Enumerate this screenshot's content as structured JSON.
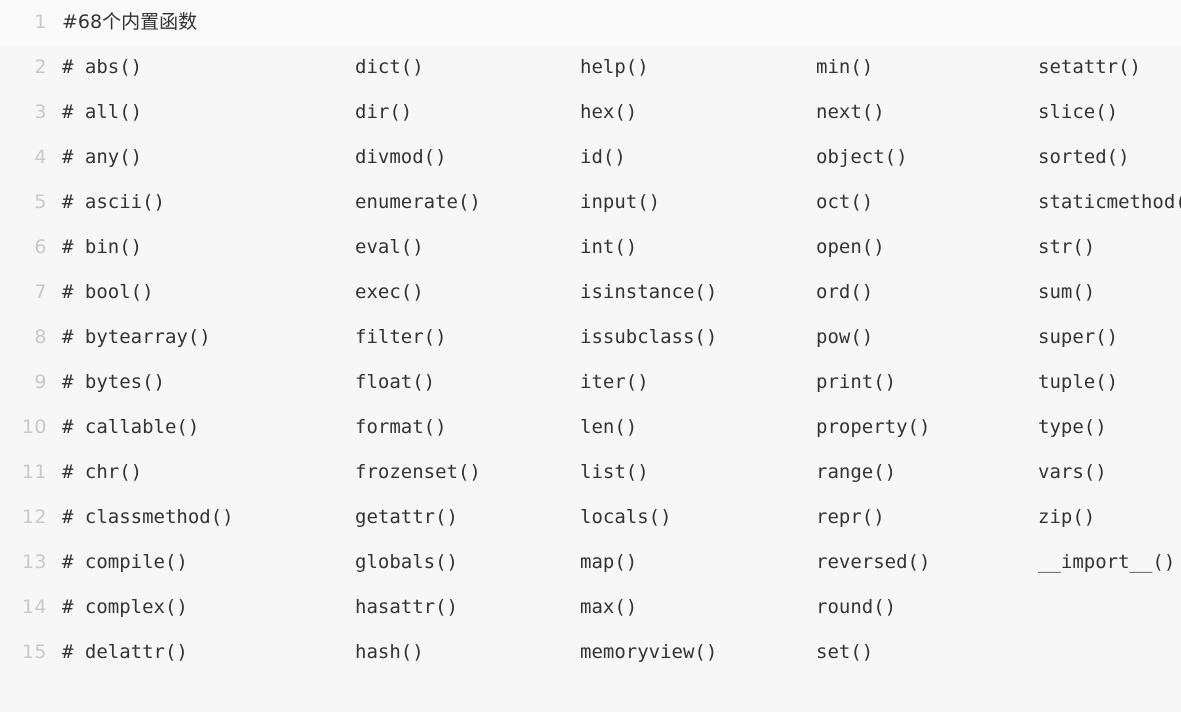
{
  "editor": {
    "background_color": "#f7f7f7",
    "active_line_color": "#fafafa",
    "text_color": "#333333",
    "line_number_color": "#c9c9c9",
    "font_size_px": 19,
    "line_height_px": 45,
    "language": "python",
    "total_lines": 15,
    "columns_x": [
      62,
      355,
      580,
      816,
      1038
    ],
    "right_edge_clipped": true
  },
  "heading": {
    "line_number": "1",
    "text": "#68个内置函数"
  },
  "line_numbers": [
    "1",
    "2",
    "3",
    "4",
    "5",
    "6",
    "7",
    "8",
    "9",
    "10",
    "11",
    "12",
    "13",
    "14",
    "15"
  ],
  "rows": [
    {
      "number": "2",
      "cells": [
        "# abs()",
        "dict()",
        "help()",
        "min()",
        "setattr()"
      ]
    },
    {
      "number": "3",
      "cells": [
        "# all()",
        "dir()",
        "hex()",
        "next()",
        "slice()"
      ]
    },
    {
      "number": "4",
      "cells": [
        "# any()",
        "divmod()",
        "id()",
        "object()",
        "sorted()"
      ]
    },
    {
      "number": "5",
      "cells": [
        "# ascii()",
        "enumerate()",
        "input()",
        "oct()",
        "staticmethod()"
      ]
    },
    {
      "number": "6",
      "cells": [
        "# bin()",
        "eval()",
        "int()",
        "open()",
        "str()"
      ]
    },
    {
      "number": "7",
      "cells": [
        "# bool()",
        "exec()",
        "isinstance()",
        "ord()",
        "sum()"
      ]
    },
    {
      "number": "8",
      "cells": [
        "# bytearray()",
        "filter()",
        "issubclass()",
        "pow()",
        "super()"
      ]
    },
    {
      "number": "9",
      "cells": [
        "# bytes()",
        "float()",
        "iter()",
        "print()",
        "tuple()"
      ]
    },
    {
      "number": "10",
      "cells": [
        "# callable()",
        "format()",
        "len()",
        "property()",
        "type()"
      ]
    },
    {
      "number": "11",
      "cells": [
        "# chr()",
        "frozenset()",
        "list()",
        "range()",
        "vars()"
      ]
    },
    {
      "number": "12",
      "cells": [
        "# classmethod()",
        "getattr()",
        "locals()",
        "repr()",
        "zip()"
      ]
    },
    {
      "number": "13",
      "cells": [
        "# compile()",
        "globals()",
        "map()",
        "reversed()",
        "__import__()"
      ]
    },
    {
      "number": "14",
      "cells": [
        "# complex()",
        "hasattr()",
        "max()",
        "round()",
        ""
      ]
    },
    {
      "number": "15",
      "cells": [
        "# delattr()",
        "hash()",
        "memoryview()",
        "set()",
        ""
      ]
    }
  ]
}
